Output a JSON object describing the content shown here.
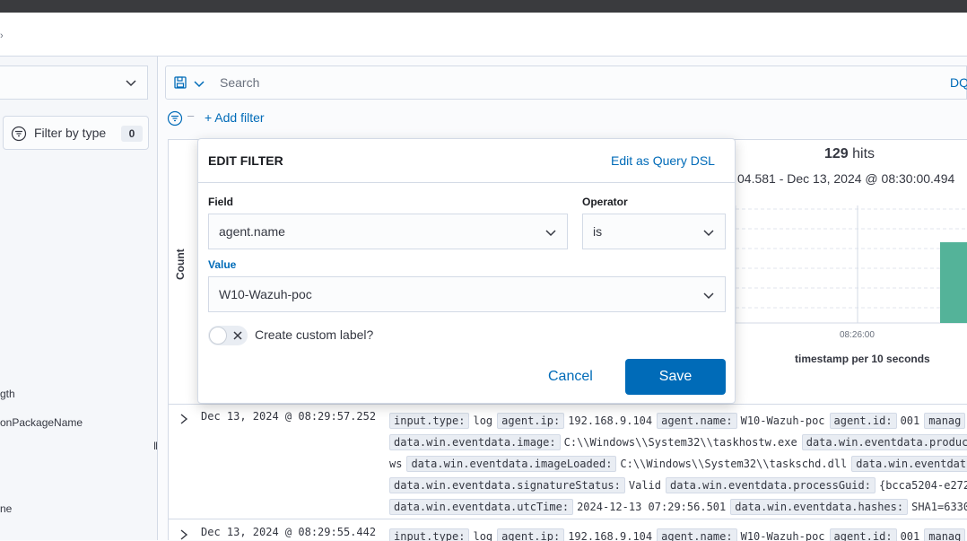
{
  "header": {
    "glyph": "›"
  },
  "sidebar": {
    "index_pattern": "",
    "filter_by_type": {
      "label": "Filter by type",
      "count": "0"
    },
    "fields": [
      {
        "name": "gth"
      },
      {
        "name": "onPackageName"
      },
      {
        "name": "ne"
      }
    ]
  },
  "query_bar": {
    "search_placeholder": "Search",
    "language_button": "DQ"
  },
  "filters": {
    "add_filter_label": "+ Add filter"
  },
  "results": {
    "hits_count": "129",
    "hits_label": " hits",
    "time_range": "04.581 - Dec 13, 2024 @ 08:30:00.494",
    "y_axis_label": "Count",
    "x_tick_label": "08:26:00",
    "x_axis_label": "timestamp per 10 seconds",
    "bar_color": "#54b399"
  },
  "documents": [
    {
      "timestamp": "Dec 13, 2024 @ 08:29:57.252",
      "lines": [
        [
          {
            "k": "input.type:",
            "v": "log"
          },
          {
            "k": "agent.ip:",
            "v": "192.168.9.104"
          },
          {
            "k": "agent.name:",
            "v": "W10-Wazuh-poc"
          },
          {
            "k": "agent.id:",
            "v": "001"
          },
          {
            "k": "manag",
            "v": ""
          }
        ],
        [
          {
            "k": "data.win.eventdata.image:",
            "v": "C:\\\\Windows\\\\System32\\\\taskhostw.exe"
          },
          {
            "k": "data.win.eventdata.produc",
            "v": ""
          }
        ],
        [
          {
            "k": "",
            "v": "ws"
          },
          {
            "k": "data.win.eventdata.imageLoaded:",
            "v": "C:\\\\Windows\\\\System32\\\\taskschd.dll"
          },
          {
            "k": "data.win.eventdat",
            "v": ""
          }
        ],
        [
          {
            "k": "data.win.eventdata.signatureStatus:",
            "v": "Valid"
          },
          {
            "k": "data.win.eventdata.processGuid:",
            "v": "{bcca5204-e272"
          }
        ],
        [
          {
            "k": "data.win.eventdata.utcTime:",
            "v": "2024-12-13 07:29:56.501"
          },
          {
            "k": "data.win.eventdata.hashes:",
            "v": "SHA1=6330"
          }
        ]
      ]
    },
    {
      "timestamp": "Dec 13, 2024 @ 08:29:55.442",
      "lines": [
        [
          {
            "k": "input.type:",
            "v": "log"
          },
          {
            "k": "agent.ip:",
            "v": "192.168.9.104"
          },
          {
            "k": "agent.name:",
            "v": "W10-Wazuh-poc"
          },
          {
            "k": "agent.id:",
            "v": "001"
          },
          {
            "k": "manag",
            "v": ""
          }
        ]
      ]
    }
  ],
  "edit_filter": {
    "title": "EDIT FILTER",
    "edit_as_dsl": "Edit as Query DSL",
    "field_label": "Field",
    "field_value": "agent.name",
    "operator_label": "Operator",
    "operator_value": "is",
    "value_label": "Value",
    "value_value": "W10-Wazuh-poc",
    "custom_label_text": "Create custom label?",
    "custom_label_enabled": false,
    "cancel_label": "Cancel",
    "save_label": "Save"
  },
  "colors": {
    "primary": "#006bb8",
    "border": "#d3dae6",
    "text": "#343741"
  }
}
